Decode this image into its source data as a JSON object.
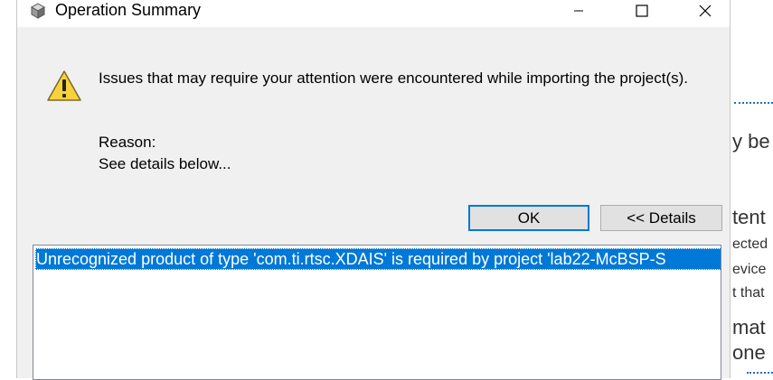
{
  "dialog": {
    "title": "Operation Summary",
    "message": "Issues that may require your attention were encountered while importing the project(s).",
    "reason_label": "Reason:",
    "reason_text": "See details below...",
    "ok_label": "OK",
    "details_label": "<< Details",
    "details_items": [
      "Unrecognized product of type 'com.ti.rtsc.XDAIS' is required by project 'lab22-McBSP-S"
    ]
  },
  "background": {
    "fragments": [
      "y be",
      "tent",
      "ected",
      "evice",
      "t that",
      "mat",
      "one"
    ]
  },
  "colors": {
    "selection": "#0078d7",
    "dialog_bg": "#f0f0f0"
  }
}
